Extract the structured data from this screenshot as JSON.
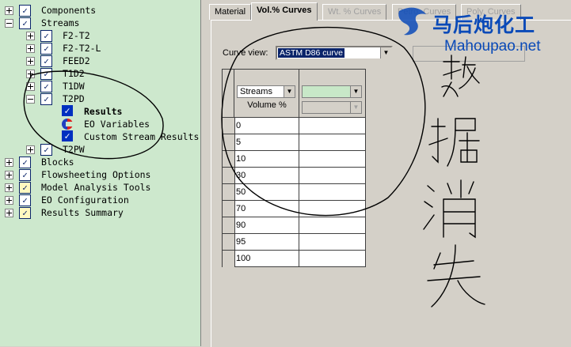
{
  "tree": {
    "items": [
      {
        "label": "Components",
        "indent": 0,
        "expander": "plus",
        "icon": "check"
      },
      {
        "label": "Streams",
        "indent": 0,
        "expander": "minus",
        "icon": "check"
      },
      {
        "label": "F2-T2",
        "indent": 1,
        "expander": "plus",
        "icon": "check"
      },
      {
        "label": "F2-T2-L",
        "indent": 1,
        "expander": "plus",
        "icon": "check"
      },
      {
        "label": "FEED2",
        "indent": 1,
        "expander": "plus",
        "icon": "check"
      },
      {
        "label": "T1D2",
        "indent": 1,
        "expander": "plus",
        "icon": "check"
      },
      {
        "label": "T1DW",
        "indent": 1,
        "expander": "plus",
        "icon": "check"
      },
      {
        "label": "T2PD",
        "indent": 1,
        "expander": "minus",
        "icon": "check"
      },
      {
        "label": "Results",
        "indent": 2,
        "expander": "none",
        "icon": "blue-check",
        "bold": true
      },
      {
        "label": "EO Variables",
        "indent": 2,
        "expander": "none",
        "icon": "eo"
      },
      {
        "label": "Custom Stream Results",
        "indent": 2,
        "expander": "none",
        "icon": "blue-check"
      },
      {
        "label": "T2PW",
        "indent": 1,
        "expander": "plus",
        "icon": "check"
      },
      {
        "label": "Blocks",
        "indent": 0,
        "expander": "plus",
        "icon": "check"
      },
      {
        "label": "Flowsheeting Options",
        "indent": 0,
        "expander": "plus",
        "icon": "check"
      },
      {
        "label": "Model Analysis Tools",
        "indent": 0,
        "expander": "plus",
        "icon": "warn"
      },
      {
        "label": "EO Configuration",
        "indent": 0,
        "expander": "plus",
        "icon": "check"
      },
      {
        "label": "Results Summary",
        "indent": 0,
        "expander": "plus",
        "icon": "warn"
      }
    ]
  },
  "tabs": [
    {
      "label": "Material",
      "state": "normal"
    },
    {
      "label": "Vol.% Curves",
      "state": "active"
    },
    {
      "label": "Wt. % Curves",
      "state": "disabled"
    },
    {
      "label": "Petro. Curves",
      "state": "disabled"
    },
    {
      "label": "Poly. Curves",
      "state": "disabled"
    }
  ],
  "curve_view": {
    "label": "Curve view:",
    "value": "ASTM D86 curve"
  },
  "grid": {
    "header_select": "Streams",
    "header_sub": "Volume %",
    "rows": [
      "0",
      "5",
      "10",
      "30",
      "50",
      "70",
      "90",
      "95",
      "100"
    ]
  },
  "annotation": {
    "text": "数据消失",
    "color": "#000000"
  },
  "watermark": {
    "cn": "马后炮化工",
    "url": "Mahoupao.net",
    "color": "#0a4ab8"
  },
  "colors": {
    "tree_bg": "#cde8cd",
    "panel_bg": "#d4d0c8",
    "selection": "#0a246a",
    "header_combo": "#c8e8c8"
  }
}
